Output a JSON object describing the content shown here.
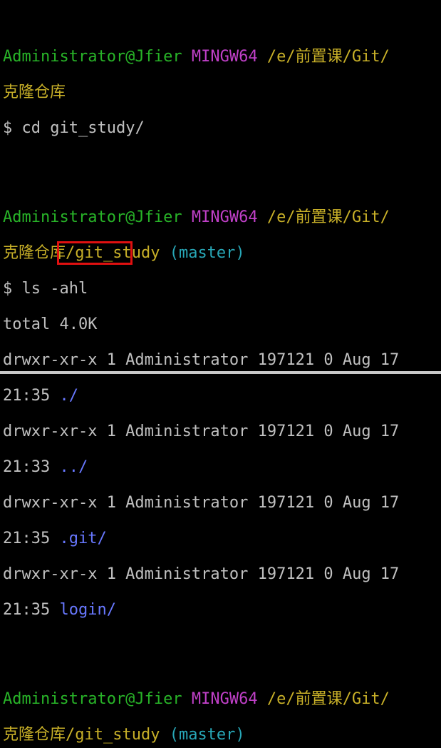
{
  "prompt": {
    "user_host": "Administrator@Jfier",
    "shell": "MINGW64",
    "path_1": "/e/前置课/Git/",
    "path_1_cont": "克隆仓库",
    "path_2": "/e/前置课/Git/",
    "path_2_cont": "克隆仓库/git_study",
    "branch": "(master)",
    "symbol": "$"
  },
  "commands": {
    "cd": "cd git_study/",
    "ls": "ls -ahl"
  },
  "listing": {
    "total": "total 4.0K",
    "rows": [
      {
        "perms": "drwxr-xr-x 1 Administrator 197121 0 Aug 17",
        "time": "21:35",
        "name": "./"
      },
      {
        "perms": "drwxr-xr-x 1 Administrator 197121 0 Aug 17",
        "time": "21:33",
        "name": "../"
      },
      {
        "perms": "drwxr-xr-x 1 Administrator 197121 0 Aug 17",
        "time": "21:35",
        "name": ".git/"
      },
      {
        "perms": "drwxr-xr-x 1 Administrator 197121 0 Aug 17",
        "time": "21:35",
        "name": "login/"
      }
    ]
  },
  "colors": {
    "user_host": "#28b428",
    "shell": "#c040c8",
    "path": "#c8b028",
    "branch": "#28a8b8",
    "directory": "#6878ff",
    "highlight": "#e01010"
  }
}
